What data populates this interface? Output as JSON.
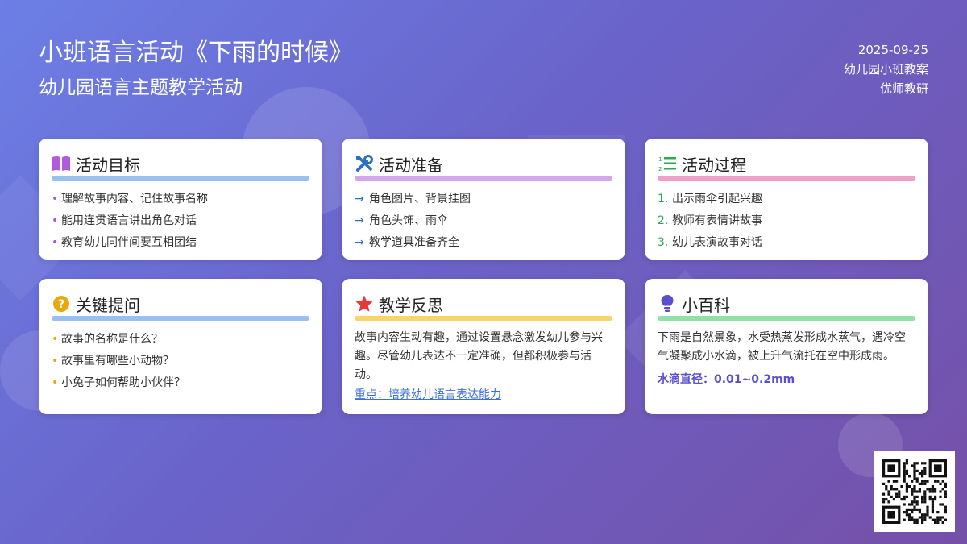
{
  "header": {
    "title": "小班语言活动《下雨的时候》",
    "subtitle": "幼儿园语言主题教学活动",
    "date": "2025-09-25",
    "doc_type": "幼儿园小班教案",
    "author": "优师教研"
  },
  "colors": {
    "goal_bar": "#98c0f0",
    "prep_bar": "#d3a6f0",
    "process_bar": "#f0a0c8",
    "question_bar": "#98c0f0",
    "reflect_bar": "#f7d56a",
    "fact_bar": "#90e0a8"
  },
  "cards": {
    "goals": {
      "icon": "open-book-icon",
      "title": "活动目标",
      "items": [
        "理解故事内容、记住故事名称",
        "能用连贯语言讲出角色对话",
        "教育幼儿同伴间要互相团结"
      ]
    },
    "prep": {
      "icon": "tools-icon",
      "title": "活动准备",
      "items": [
        "角色图片、背景挂图",
        "角色头饰、雨伞",
        "教学道具准备齐全"
      ]
    },
    "process": {
      "icon": "numbered-list-icon",
      "title": "活动过程",
      "items": [
        {
          "num": "1.",
          "text": "出示雨伞引起兴趣"
        },
        {
          "num": "2.",
          "text": "教师有表情讲故事"
        },
        {
          "num": "3.",
          "text": "幼儿表演故事对话"
        }
      ]
    },
    "questions": {
      "icon": "question-icon",
      "title": "关键提问",
      "items": [
        "故事的名称是什么？",
        "故事里有哪些小动物？",
        "小兔子如何帮助小伙伴？"
      ]
    },
    "reflection": {
      "icon": "star-icon",
      "title": "教学反思",
      "text": "故事内容生动有趣，通过设置悬念激发幼儿参与兴趣。尽管幼儿表达不一定准确，但都积极参与活动。",
      "link": "重点：培养幼儿语言表达能力"
    },
    "encyclopedia": {
      "icon": "lightbulb-icon",
      "title": "小百科",
      "text": "下雨是自然景象，水受热蒸发形成水蒸气，遇冷空气凝聚成小水滴，被上升气流托在空中形成雨。",
      "fact": "水滴直径：0.01~0.2mm"
    }
  }
}
